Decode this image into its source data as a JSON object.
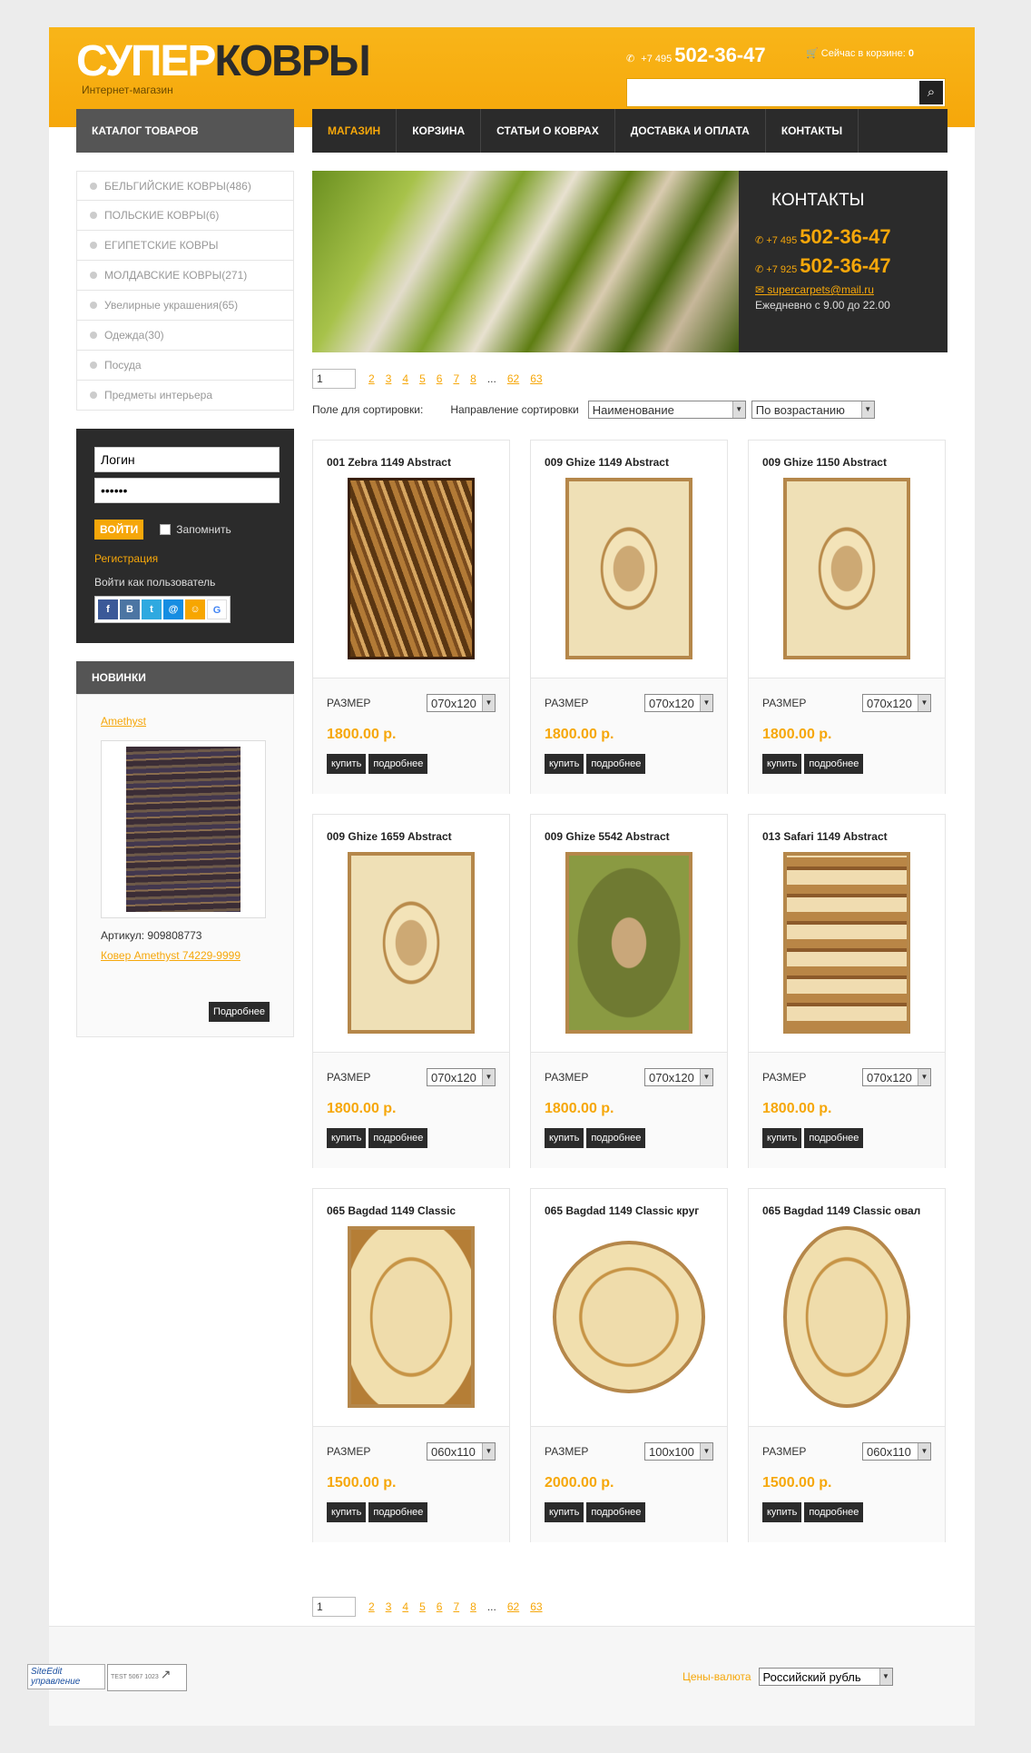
{
  "header": {
    "logo_light": "СУПЕР",
    "logo_dark": "КОВРЫ",
    "tagline": "Интернет-магазин",
    "phone_prefix": "+7 495",
    "phone_number": "502-36-47",
    "cart_text": "Сейчас в корзине:",
    "cart_count": "0",
    "search_placeholder": ""
  },
  "nav": {
    "items": [
      "МАГАЗИН",
      "КОРЗИНА",
      "СТАТЬИ О КОВРАХ",
      "ДОСТАВКА И ОПЛАТА",
      "КОНТАКТЫ"
    ],
    "active": "МАГАЗИН"
  },
  "sidebar": {
    "catalog_title": "КАТАЛОГ ТОВАРОВ",
    "categories": [
      "БЕЛЬГИЙСКИЕ КОВРЫ(486)",
      "ПОЛЬСКИЕ КОВРЫ(6)",
      "ЕГИПЕТСКИЕ КОВРЫ",
      "МОЛДАВСКИЕ КОВРЫ(271)",
      "Увелирные украшения(65)",
      "Одежда(30)",
      "Посуда",
      "Предметы интерьера"
    ],
    "login": {
      "username_value": "Логин",
      "password_value": "••••••",
      "login_button": "ВОЙТИ",
      "remember_label": "Запомнить",
      "register_link": "Регистрация",
      "login_as": "Войти как пользователь",
      "social": [
        "f",
        "B",
        "t",
        "@",
        "☺",
        "G"
      ]
    },
    "new_items": {
      "title": "НОВИНКИ",
      "name_link": "Amethyst",
      "sku": "Артикул: 909808773",
      "product_link": "Ковер Amethyst 74229-9999",
      "more_button": "Подробнее"
    }
  },
  "banner": {
    "title": "КОНТАКТЫ",
    "phones": [
      {
        "prefix": "+7 495",
        "number": "502-36-47"
      },
      {
        "prefix": "+7 925",
        "number": "502-36-47"
      }
    ],
    "email": "supercarpets@mail.ru",
    "hours": "Ежедневно с 9.00 до 22.00"
  },
  "pagination": {
    "current": "1",
    "pages": [
      "2",
      "3",
      "4",
      "5",
      "6",
      "7",
      "8"
    ],
    "ellipsis": "...",
    "last_pages": [
      "62",
      "63"
    ]
  },
  "sorting": {
    "field_label": "Поле для сортировки:",
    "direction_label": "Направление сортировки",
    "field_value": "Наименование",
    "direction_value": "По возрастанию"
  },
  "product_labels": {
    "size_label": "РАЗМЕР",
    "buy_button": "купить",
    "more_button": "подробнее"
  },
  "products": [
    {
      "title": "001 Zebra 1149 Abstract",
      "size": "070x120",
      "price": "1800.00 р.",
      "shape": "rect",
      "style": "zebra"
    },
    {
      "title": "009 Ghize 1149 Abstract",
      "size": "070x120",
      "price": "1800.00 р.",
      "shape": "rect",
      "style": "ghize"
    },
    {
      "title": "009 Ghize 1150 Abstract",
      "size": "070x120",
      "price": "1800.00 р.",
      "shape": "rect",
      "style": "ghize"
    },
    {
      "title": "009 Ghize 1659 Abstract",
      "size": "070x120",
      "price": "1800.00 р.",
      "shape": "rect",
      "style": "ghize"
    },
    {
      "title": "009 Ghize 5542 Abstract",
      "size": "070x120",
      "price": "1800.00 р.",
      "shape": "rect",
      "style": "green"
    },
    {
      "title": "013 Safari 1149 Abstract",
      "size": "070x120",
      "price": "1800.00 р.",
      "shape": "rect",
      "style": "safari"
    },
    {
      "title": "065 Bagdad 1149 Classic",
      "size": "060x110",
      "price": "1500.00 р.",
      "shape": "rect",
      "style": "bagdad"
    },
    {
      "title": "065 Bagdad 1149 Classic круг",
      "size": "100x100",
      "price": "2000.00 р.",
      "shape": "round",
      "style": "bagdad"
    },
    {
      "title": "065 Bagdad 1149 Classic овал",
      "size": "060x110",
      "price": "1500.00 р.",
      "shape": "oval",
      "style": "bagdad"
    }
  ],
  "footer": {
    "siteedit_label": "SiteEdit управление",
    "counter_label": "TEST 5067 1023",
    "currency_label": "Цены-валюта",
    "currency_value": "Российский рубль"
  },
  "colors": {
    "accent": "#f6a70a",
    "dark": "#2b2b2b",
    "panel_gray": "#555555"
  }
}
